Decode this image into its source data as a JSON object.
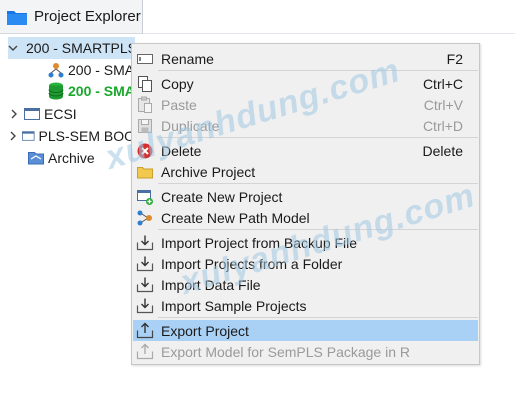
{
  "tab": {
    "title": "Project Explorer"
  },
  "tree": {
    "items": [
      {
        "label": "200 - SMARTPLS"
      },
      {
        "label": "200 - SMA"
      },
      {
        "label": "200 - SMA"
      },
      {
        "label": "ECSI"
      },
      {
        "label": "PLS-SEM BOO"
      },
      {
        "label": "Archive"
      }
    ]
  },
  "menu": {
    "items": [
      {
        "label": "Rename",
        "shortcut": "F2",
        "icon": "rename-icon",
        "enabled": true
      },
      {
        "label": "Copy",
        "shortcut": "Ctrl+C",
        "icon": "copy-icon",
        "enabled": true
      },
      {
        "label": "Paste",
        "shortcut": "Ctrl+V",
        "icon": "paste-icon",
        "enabled": false
      },
      {
        "label": "Duplicate",
        "shortcut": "Ctrl+D",
        "icon": "duplicate-icon",
        "enabled": false
      },
      {
        "label": "Delete",
        "shortcut": "Delete",
        "icon": "delete-icon",
        "enabled": true
      },
      {
        "label": "Archive Project",
        "shortcut": "",
        "icon": "folder-icon",
        "enabled": true
      },
      {
        "label": "Create New Project",
        "shortcut": "",
        "icon": "new-project-icon",
        "enabled": true
      },
      {
        "label": "Create New Path Model",
        "shortcut": "",
        "icon": "path-model-icon",
        "enabled": true
      },
      {
        "label": "Import Project from Backup File",
        "shortcut": "",
        "icon": "import-icon",
        "enabled": true
      },
      {
        "label": "Import Projects from a Folder",
        "shortcut": "",
        "icon": "import-icon",
        "enabled": true
      },
      {
        "label": "Import Data File",
        "shortcut": "",
        "icon": "import-icon",
        "enabled": true
      },
      {
        "label": "Import Sample Projects",
        "shortcut": "",
        "icon": "import-icon",
        "enabled": true
      },
      {
        "label": "Export Project",
        "shortcut": "",
        "icon": "export-icon",
        "enabled": true,
        "highlighted": true
      },
      {
        "label": "Export Model for SemPLS Package in R",
        "shortcut": "",
        "icon": "export-icon",
        "enabled": false
      }
    ]
  },
  "watermark": "xulyanhdung.com",
  "colors": {
    "highlight": "#a9d0f5",
    "selection": "#cde4f7",
    "active_model": "#19a82b",
    "menu_bg": "#f0f0f0",
    "disabled_text": "#9a9a9a"
  }
}
